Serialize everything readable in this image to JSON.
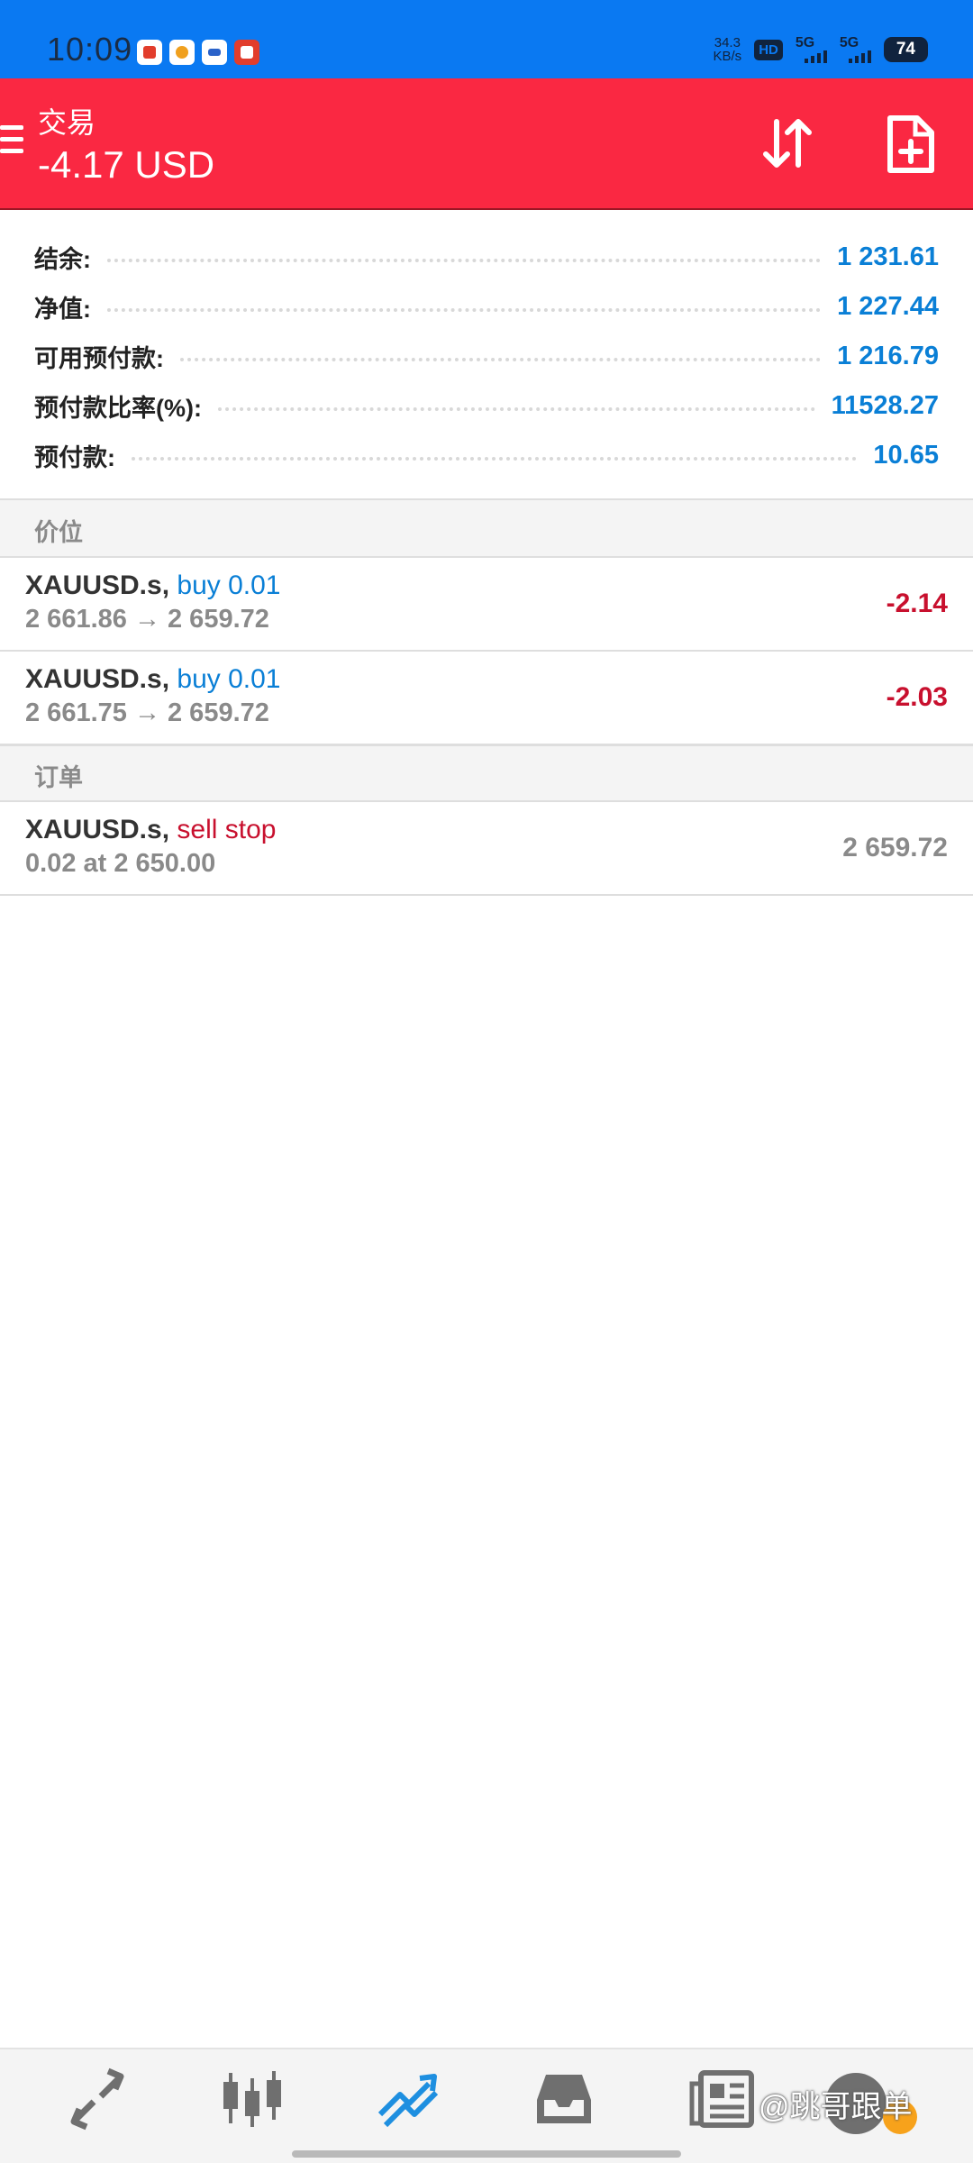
{
  "status_bar": {
    "time": "10:09",
    "speed_value": "34.3",
    "speed_unit": "KB/s",
    "hd_label": "HD",
    "net1": "5G",
    "net2": "5G",
    "battery": "74"
  },
  "header": {
    "title": "交易",
    "profit": "-4.17 USD"
  },
  "summary": [
    {
      "label": "结余:",
      "value": "1 231.61"
    },
    {
      "label": "净值:",
      "value": "1 227.44"
    },
    {
      "label": "可用预付款:",
      "value": "1 216.79"
    },
    {
      "label": "预付款比率(%):",
      "value": "11528.27"
    },
    {
      "label": "预付款:",
      "value": "10.65"
    }
  ],
  "positions_section": "价位",
  "positions": [
    {
      "symbol": "XAUUSD.s,",
      "side": "buy 0.01",
      "prices": "2 661.86 → 2 659.72",
      "profit": "-2.14"
    },
    {
      "symbol": "XAUUSD.s,",
      "side": "buy 0.01",
      "prices": "2 661.75 → 2 659.72",
      "profit": "-2.03"
    }
  ],
  "orders_section": "订单",
  "orders": [
    {
      "symbol": "XAUUSD.s,",
      "type": "sell stop",
      "detail": "0.02 at 2 650.00",
      "price": "2 659.72"
    }
  ],
  "bottom_nav": {
    "items": [
      "quotes-icon",
      "chart-icon",
      "trade-icon",
      "history-icon",
      "news-icon"
    ],
    "active": "trade-icon",
    "active_color": "#1e8fe0",
    "inactive_color": "#6f6f6f"
  },
  "watermark": "@跳哥跟单",
  "colors": {
    "status_bar": "#0a79f2",
    "header": "#fa2842",
    "value_blue": "#0a7fd6",
    "loss_red": "#c8102e"
  }
}
